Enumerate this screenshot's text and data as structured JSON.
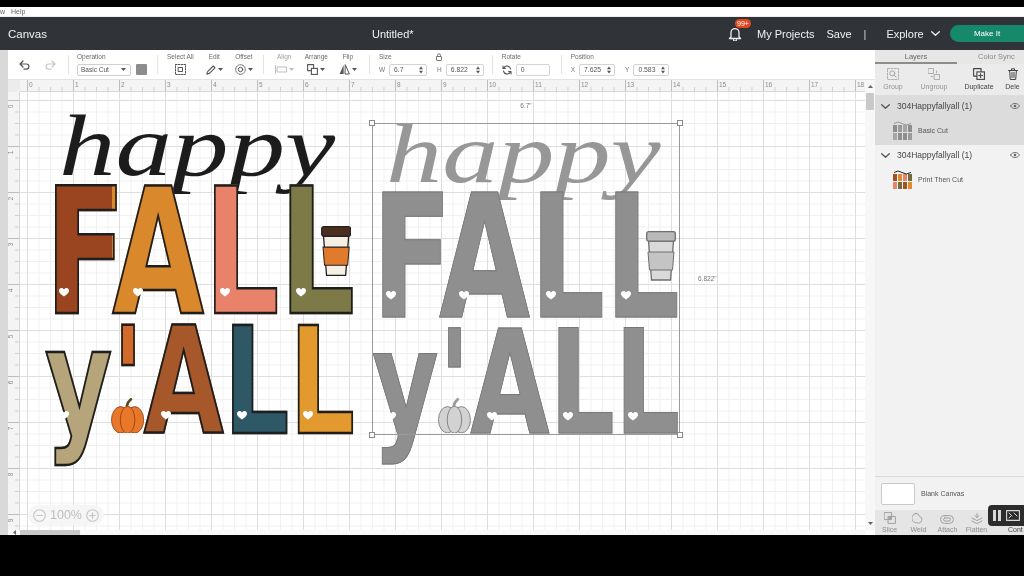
{
  "menu_bar": {
    "items": [
      "w",
      "Help"
    ]
  },
  "header": {
    "section": "Canvas",
    "document_title": "Untitled*",
    "notification_badge": "99+",
    "links": [
      "My Projects",
      "Save"
    ],
    "divider": "|",
    "explore": "Explore",
    "make_it": "Make It"
  },
  "toolbar": {
    "history": [
      {
        "kind": "undo",
        "disabled": false
      },
      {
        "kind": "redo",
        "disabled": true
      }
    ],
    "operation": {
      "label": "Operation",
      "value": "Basic Cut",
      "color": "#8c8c8c"
    },
    "edit_tools": [
      {
        "kind": "select_all",
        "label": "Select All",
        "disabled": false
      },
      {
        "kind": "edit",
        "label": "Edit",
        "disabled": false
      },
      {
        "kind": "offset",
        "label": "Offset",
        "disabled": false
      }
    ],
    "arrange_tools": [
      {
        "kind": "align",
        "label": "Align",
        "disabled": true
      },
      {
        "kind": "arrange",
        "label": "Arrange",
        "disabled": false
      },
      {
        "kind": "flip",
        "label": "Flip",
        "disabled": false
      }
    ],
    "size": {
      "label": "Size",
      "fields": [
        {
          "axis": "W",
          "value": "6.7"
        },
        {
          "axis": "H",
          "value": "6.822"
        }
      ]
    },
    "rotate": {
      "label": "Rotate",
      "value": "0"
    },
    "position": {
      "label": "Position",
      "fields": [
        {
          "axis": "X",
          "value": "7.625"
        },
        {
          "axis": "Y",
          "value": "0.583"
        }
      ]
    }
  },
  "canvas": {
    "ruler_horizontal": [
      "0",
      "1",
      "2",
      "3",
      "4",
      "5",
      "6",
      "7",
      "8",
      "9",
      "10",
      "11",
      "12",
      "13",
      "14",
      "15",
      "16",
      "17",
      "18"
    ],
    "ruler_vertical": [
      "0",
      "1",
      "2",
      "3",
      "4",
      "5",
      "6",
      "7",
      "8",
      "9"
    ],
    "designs": [
      {
        "kind": "print",
        "script": "happy",
        "line_1": "FALL",
        "line_2": "y'ALL",
        "selected": false
      },
      {
        "kind": "cut",
        "script": "happy",
        "line_1": "FALL",
        "line_2": "y'ALL",
        "selected": true
      }
    ],
    "selection": {
      "width_label": "6.7\"",
      "height_label": "6.822\""
    },
    "zoom": "100%"
  },
  "layers_panel": {
    "tabs": [
      {
        "label": "Layers",
        "selected": true
      },
      {
        "label": "Color Sync",
        "selected": false
      }
    ],
    "actions": [
      {
        "kind": "group",
        "label": "Group",
        "disabled": true
      },
      {
        "kind": "ungroup",
        "label": "Ungroup",
        "disabled": true
      },
      {
        "kind": "duplicate",
        "label": "Duplicate",
        "disabled": false
      },
      {
        "kind": "delete",
        "label": "Dele",
        "disabled": false
      }
    ],
    "groups": [
      {
        "name": "304Happyfallyall (1)",
        "selected": true,
        "expanded": true,
        "visible": true,
        "children": [
          {
            "kind": "cut",
            "label": "Basic Cut"
          }
        ]
      },
      {
        "name": "304Happyfallyall (1)",
        "selected": false,
        "expanded": true,
        "visible": true,
        "children": [
          {
            "kind": "print",
            "label": "Print Then Cut"
          }
        ]
      }
    ],
    "canvas_layer": {
      "label": "Blank Canvas"
    },
    "bottom_actions": [
      {
        "kind": "slice",
        "label": "Slice",
        "disabled": true
      },
      {
        "kind": "weld",
        "label": "Weld",
        "disabled": true
      },
      {
        "kind": "attach",
        "label": "Attach",
        "disabled": true
      },
      {
        "kind": "flatten",
        "label": "Flatten",
        "disabled": true
      },
      {
        "kind": "contour",
        "label": "Cont",
        "disabled": false
      }
    ]
  }
}
